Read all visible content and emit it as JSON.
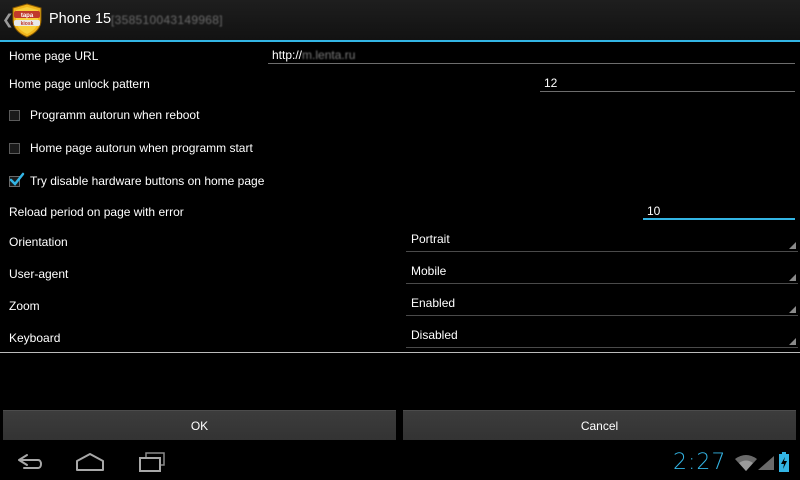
{
  "header": {
    "title": "Phone 15",
    "subtitle": "[358510043149968]",
    "logo_text_top": "tapa",
    "logo_text_bottom": "kiosk"
  },
  "settings": {
    "home_url": {
      "label": "Home page URL",
      "value_prefix": "http://",
      "value_blurred": "m.lenta.ru"
    },
    "unlock_pattern": {
      "label": "Home page unlock pattern",
      "value": "12"
    },
    "autorun_reboot": {
      "label": "Programm autorun when reboot",
      "checked": false
    },
    "autorun_start": {
      "label": "Home page autorun when programm start",
      "checked": false
    },
    "disable_hw_buttons": {
      "label": "Try disable hardware buttons on home page",
      "checked": true
    },
    "reload_period": {
      "label": "Reload period on page with error",
      "value": "10"
    },
    "orientation": {
      "label": "Orientation",
      "value": "Portrait"
    },
    "user_agent": {
      "label": "User-agent",
      "value": "Mobile"
    },
    "zoom": {
      "label": "Zoom",
      "value": "Enabled"
    },
    "keyboard": {
      "label": "Keyboard",
      "value": "Disabled"
    }
  },
  "buttons": {
    "ok": "OK",
    "cancel": "Cancel"
  },
  "statusbar": {
    "time": "2:27"
  },
  "colors": {
    "accent": "#33b5e5",
    "background": "#000000",
    "button": "#3a3a3a"
  },
  "icons": [
    "up-chevron-icon",
    "app-logo-icon",
    "back-icon",
    "home-icon",
    "recent-apps-icon",
    "wifi-icon",
    "signal-icon",
    "battery-charging-icon"
  ]
}
